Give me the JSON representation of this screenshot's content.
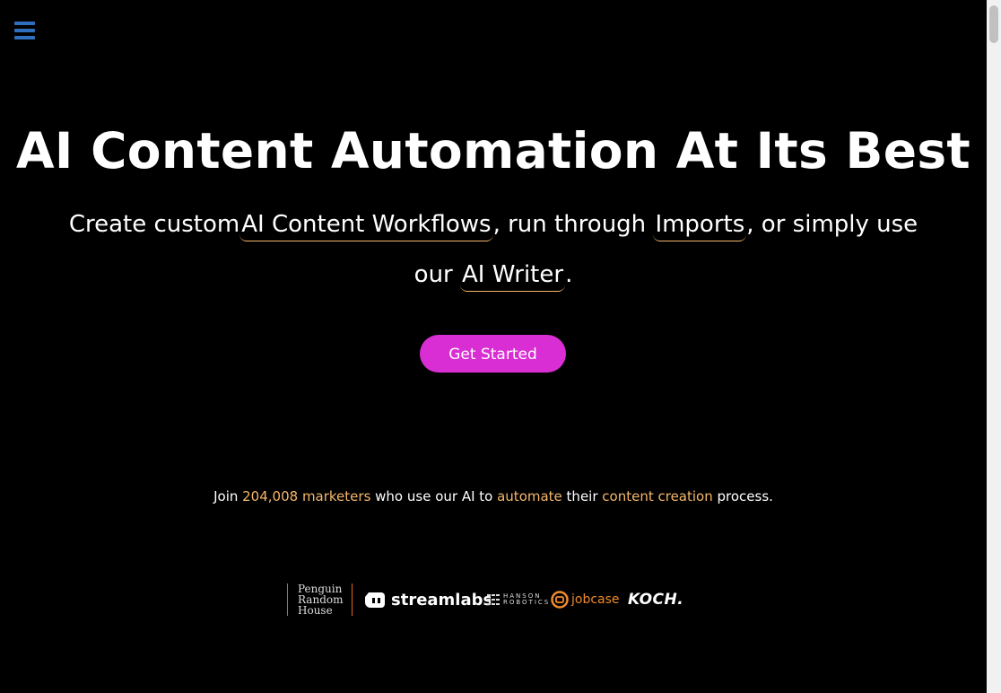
{
  "nav": {
    "menu_icon": "hamburger-menu-icon"
  },
  "hero": {
    "title": "AI Content Automation At Its Best",
    "sub_part1": "Create custom",
    "link_workflows": "AI Content Workflows",
    "sub_part2": ", run through ",
    "link_imports": "Imports",
    "sub_part3": ", or simply use our ",
    "link_writer": "AI Writer",
    "sub_part4": ".",
    "cta_label": "Get Started"
  },
  "social_proof": {
    "pre": "Join ",
    "count": "204,008 marketers",
    "mid1": " who use our AI to ",
    "word_automate": "automate",
    "mid2": " their ",
    "word_content": "content creation",
    "post": " process."
  },
  "logos": {
    "prh_line1": "Penguin",
    "prh_line2": "Random",
    "prh_line3": "House",
    "streamlabs": "streamlabs",
    "hanson_line1": "HANSON",
    "hanson_line2": "ROBOTICS",
    "jobcase": "jobcase",
    "koch": "KOCH."
  },
  "colors": {
    "accent_orange": "#f4b66a",
    "cta_magenta": "#d92ed3",
    "menu_blue": "#2f6fbd",
    "background": "#000000"
  }
}
